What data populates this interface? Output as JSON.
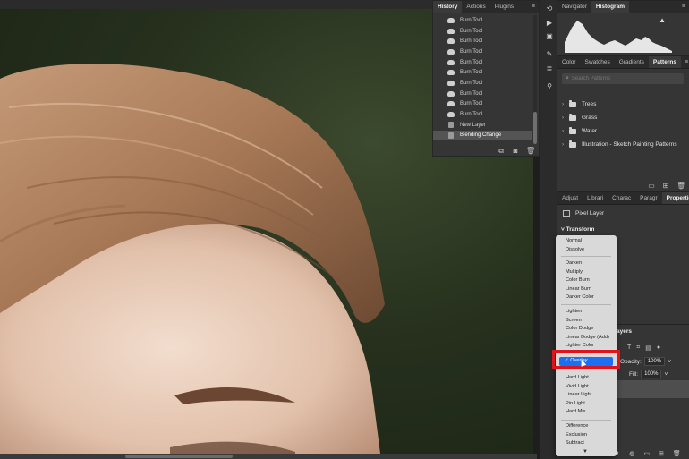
{
  "history": {
    "tabs": [
      "History",
      "Actions",
      "Plugins"
    ],
    "items": [
      "Burn Tool",
      "Burn Tool",
      "Burn Tool",
      "Burn Tool",
      "Burn Tool",
      "Burn Tool",
      "Burn Tool",
      "Burn Tool",
      "Burn Tool",
      "Burn Tool",
      "New Layer",
      "Blending Change"
    ],
    "selected_index": 11
  },
  "navigator": {
    "tabs": [
      "Navigator",
      "Histogram"
    ]
  },
  "patterns": {
    "tabs": [
      "Color",
      "Swatches",
      "Gradients",
      "Patterns"
    ],
    "search_placeholder": "Search Patterns",
    "folders": [
      "Trees",
      "Grass",
      "Water",
      "Illustration - Sketch Painting Patterns"
    ]
  },
  "properties": {
    "tabs": [
      "Adjust",
      "Librari",
      "Charac",
      "Paragr",
      "Properties"
    ],
    "layer_type": "Pixel Layer",
    "section": "Transform"
  },
  "layers": {
    "tab": "Layers",
    "opacity_label": "Opacity:",
    "opacity_value": "100%",
    "fill_label": "Fill:",
    "fill_value": "100%"
  },
  "blend_modes": {
    "groups": [
      [
        "Normal",
        "Dissolve"
      ],
      [
        "Darken",
        "Multiply",
        "Color Burn",
        "Linear Burn",
        "Darker Color"
      ],
      [
        "Lighten",
        "Screen",
        "Color Dodge",
        "Linear Dodge (Add)",
        "Lighter Color"
      ],
      [
        "Overlay",
        "",
        "Hard Light",
        "Vivid Light",
        "Linear Light",
        "Pin Light",
        "Hard Mix"
      ],
      [
        "Difference",
        "Exclusion",
        "Subtract"
      ]
    ],
    "selected": "Overlay",
    "checkmark": "✓"
  },
  "colors": {
    "selection": "#1c6ef2",
    "highlight_box": "#e0121a",
    "panel_bg": "#353535"
  }
}
